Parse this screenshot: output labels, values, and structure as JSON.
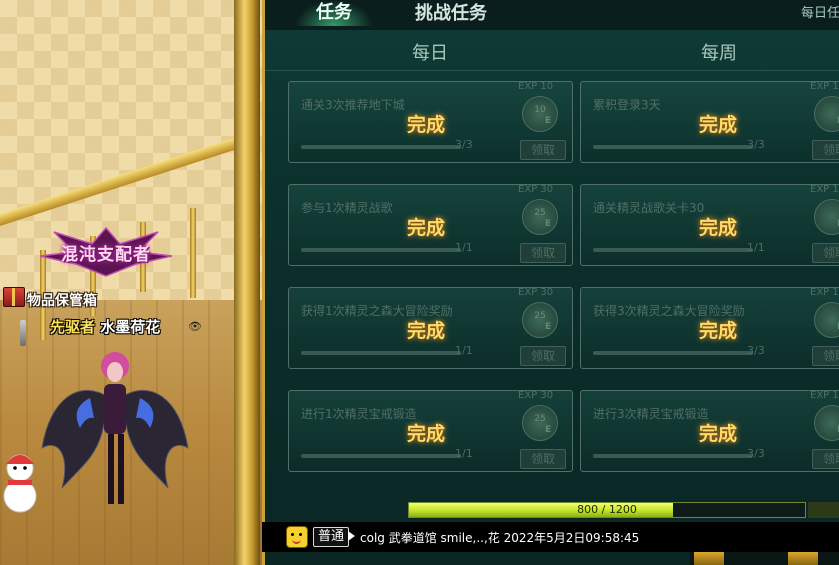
{
  "world": {
    "title_badge": "混沌支配者",
    "storage_box_label": "物品保管箱",
    "player_prefix": "先驱者",
    "player_name": "水墨荷花"
  },
  "panel": {
    "tabs": {
      "tasks": "任务",
      "challenge": "挑战任务",
      "daily_right": "每日任"
    },
    "columns": {
      "daily": "每日",
      "weekly": "每周"
    },
    "complete_label": "完成",
    "claim_label": "领取",
    "daily_tasks": [
      {
        "title": "通关3次推荐地下城",
        "count": "3/3",
        "exp": "EXP 10",
        "badge": "10"
      },
      {
        "title": "参与1次精灵战歌",
        "count": "1/1",
        "exp": "EXP 30",
        "badge": "25"
      },
      {
        "title": "获得1次精灵之森大冒险奖励",
        "count": "1/1",
        "exp": "EXP 30",
        "badge": "25"
      },
      {
        "title": "进行1次精灵宝戒锻造",
        "count": "1/1",
        "exp": "EXP 30",
        "badge": "25"
      }
    ],
    "weekly_tasks": [
      {
        "title": "累积登录3天",
        "count": "3/3",
        "exp": "EXP 1",
        "badge": ""
      },
      {
        "title": "通关精灵战歌关卡30",
        "count": "1/1",
        "exp": "EXP 1",
        "badge": ""
      },
      {
        "title": "获得3次精灵之森大冒险奖励",
        "count": "3/3",
        "exp": "EXP 1",
        "badge": ""
      },
      {
        "title": "进行3次精灵宝戒锻造",
        "count": "3/3",
        "exp": "EXP 1",
        "badge": ""
      }
    ]
  },
  "xp": {
    "text": "800 / 1200",
    "progress": 0.667
  },
  "chat": {
    "channel": "普通",
    "message": "colg 武拳道馆 smile,..,花 2022年5月2日09:58:45"
  }
}
